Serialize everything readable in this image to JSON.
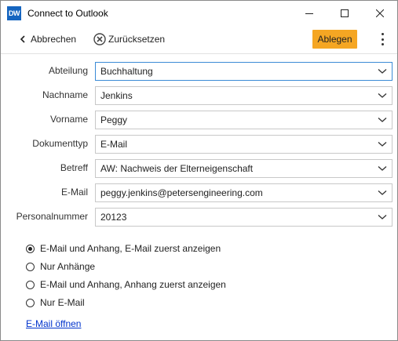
{
  "window": {
    "title": "Connect to Outlook",
    "app_icon_text": "DW"
  },
  "toolbar": {
    "back_label": "Abbrechen",
    "reset_label": "Zurücksetzen",
    "file_label": "Ablegen",
    "accent_color": "#f5a623"
  },
  "form": {
    "fields": [
      {
        "label": "Abteilung",
        "value": "Buchhaltung"
      },
      {
        "label": "Nachname",
        "value": "Jenkins"
      },
      {
        "label": "Vorname",
        "value": "Peggy"
      },
      {
        "label": "Dokumenttyp",
        "value": "E-Mail"
      },
      {
        "label": "Betreff",
        "value": "AW: Nachweis der Elterneigenschaft"
      },
      {
        "label": "E-Mail",
        "value": "peggy.jenkins@petersengineering.com"
      },
      {
        "label": "Personalnummer",
        "value": "20123"
      }
    ]
  },
  "options": {
    "selected_index": 0,
    "items": [
      {
        "label": "E-Mail und Anhang, E-Mail zuerst anzeigen"
      },
      {
        "label": "Nur Anhänge"
      },
      {
        "label": "E-Mail und Anhang, Anhang zuerst anzeigen"
      },
      {
        "label": "Nur E-Mail"
      }
    ]
  },
  "link": {
    "open_email": "E-Mail öffnen"
  }
}
